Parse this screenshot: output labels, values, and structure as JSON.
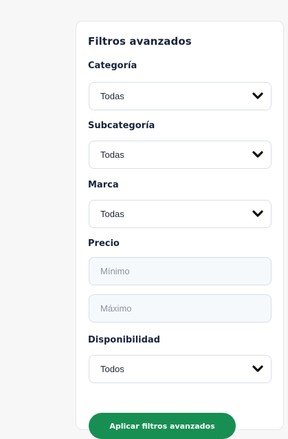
{
  "panel": {
    "title": "Filtros avanzados",
    "fields": {
      "categoria": {
        "label": "Categoría",
        "value": "Todas"
      },
      "subcategoria": {
        "label": "Subcategoría",
        "value": "Todas"
      },
      "marca": {
        "label": "Marca",
        "value": "Todas"
      },
      "precio": {
        "label": "Precio",
        "min_placeholder": "Mínimo",
        "max_placeholder": "Máximo"
      },
      "disponibilidad": {
        "label": "Disponibilidad",
        "value": "Todos"
      }
    },
    "apply_button": "Aplicar filtros avanzados"
  },
  "icons": {
    "select_arrow": "chevron-down-icon"
  },
  "colors": {
    "accent": "#188f52",
    "text": "#17233c",
    "border": "#d8dee8"
  }
}
